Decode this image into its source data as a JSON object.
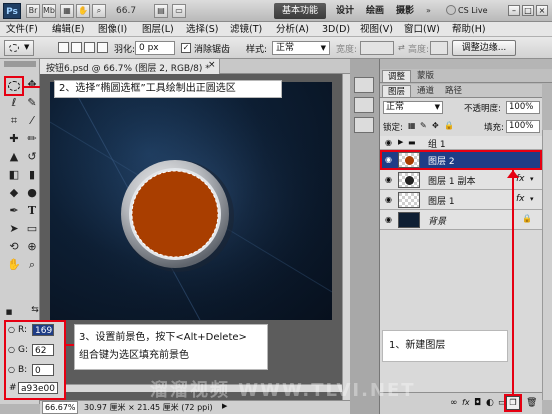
{
  "titlebar": {
    "logo": "Ps",
    "zoom": "66.7",
    "workspaces": [
      "基本功能",
      "设计",
      "绘画",
      "摄影"
    ],
    "cslive": "CS Live"
  },
  "menu": [
    "文件(F)",
    "编辑(E)",
    "图像(I)",
    "图层(L)",
    "选择(S)",
    "滤镜(T)",
    "分析(A)",
    "3D(D)",
    "视图(V)",
    "窗口(W)",
    "帮助(H)"
  ],
  "options": {
    "feather_label": "羽化:",
    "feather_value": "0 px",
    "antialias_label": "消除锯齿",
    "style_label": "样式:",
    "style_value": "正常",
    "width_label": "宽度:",
    "height_label": "高度:",
    "refine_edge": "调整边缘..."
  },
  "document": {
    "tab_title": "按钮6.psd @ 66.7% (图层 2, RGB/8) *",
    "status_zoom": "66.67%",
    "status_info": "30.97 厘米 × 21.45 厘米 (72 ppi)"
  },
  "panels": {
    "top_tabs": [
      "调整",
      "蒙版"
    ],
    "layer_tabs": [
      "图层",
      "通道",
      "路径"
    ],
    "blend_mode": "正常",
    "opacity_label": "不透明度:",
    "opacity_value": "100%",
    "lock_label": "锁定:",
    "fill_label": "填充:",
    "fill_value": "100%",
    "layers": [
      {
        "name": "组 1",
        "kind": "group"
      },
      {
        "name": "图层 2",
        "kind": "active"
      },
      {
        "name": "图层 1 副本",
        "kind": "fx"
      },
      {
        "name": "图层 1",
        "kind": "fx"
      },
      {
        "name": "背景",
        "kind": "background"
      }
    ],
    "fx_label": "fx"
  },
  "color_picker": {
    "r_label": "R:",
    "r_value": "169",
    "g_label": "G:",
    "g_value": "62",
    "b_label": "B:",
    "b_value": "0",
    "hex_label": "#",
    "hex_value": "a93e00"
  },
  "annotations": {
    "step2": "2、选择“椭圆选框”工具绘制出正圆选区",
    "step3_line1": "3、设置前景色，按下<Alt+Delete>",
    "step3_line2": "组合键为选区填充前景色",
    "step1": "1、新建图层"
  },
  "watermark": "溜溜视频 WWW.TLVI.NET",
  "colors": {
    "foreground": "#a93e00",
    "annotation_red": "#e60012",
    "active_layer": "#1f3d86"
  }
}
